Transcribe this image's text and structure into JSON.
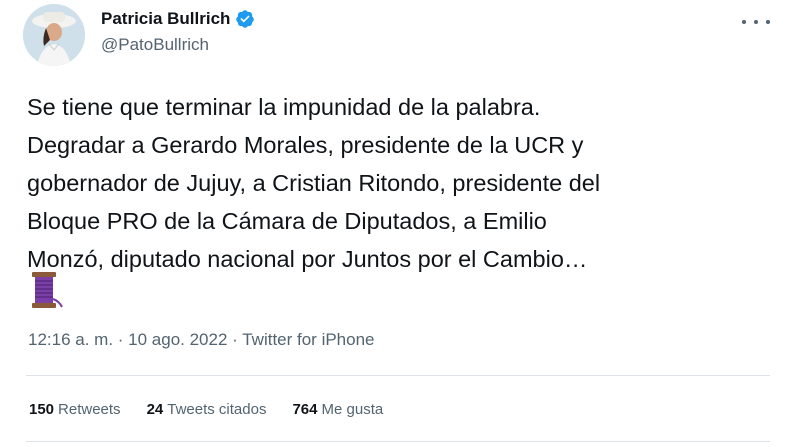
{
  "user": {
    "name": "Patricia Bullrich",
    "handle": "@PatoBullrich",
    "verified": true
  },
  "tweet": {
    "text": "Se tiene que terminar la impunidad de la palabra.\nDegradar a Gerardo Morales, presidente de la UCR y\ngobernador de Jujuy, a Cristian Ritondo, presidente del\nBloque PRO de la Cámara de Diputados, a Emilio\nMonzó, diputado nacional por Juntos por el Cambio…",
    "emoji": "thread-spool-emoji",
    "meta": "12:16 a. m. · 10 ago. 2022 · Twitter for iPhone"
  },
  "stats": {
    "retweets_count": "150",
    "retweets_label": "Retweets",
    "quotes_count": "24",
    "quotes_label": "Tweets citados",
    "likes_count": "764",
    "likes_label": "Me gusta"
  },
  "colors": {
    "verified": "#1d9bf0",
    "secondary_text": "#536471",
    "primary_text": "#0f1419"
  },
  "icons": [
    "verified-badge-icon",
    "more-options-icon",
    "thread-emoji-icon"
  ]
}
